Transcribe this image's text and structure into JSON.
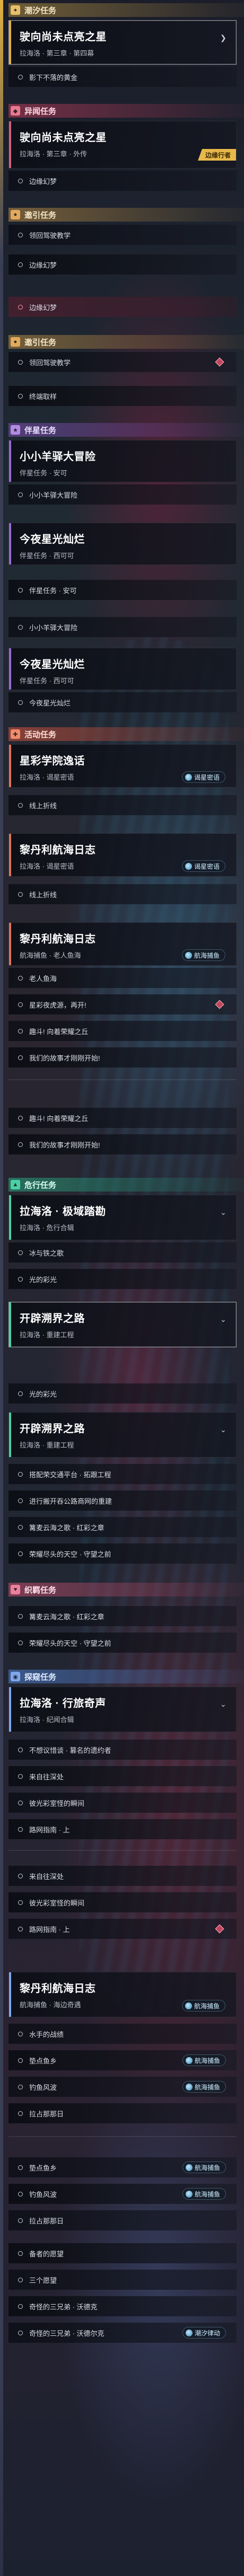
{
  "categories": {
    "tide": "潮汐任务",
    "odd": "异闻任务",
    "guide": "邀引任务",
    "partner": "伴星任务",
    "event": "活动任务",
    "danger": "危行任务",
    "bond": "织羁任务",
    "discovery": "探窥任务"
  },
  "quests": {
    "q1": {
      "title": "驶向尚未点亮之星",
      "sub": "拉海洛 · 第三章 · 第四幕"
    },
    "q2": {
      "title": "驶向尚未点亮之星",
      "sub": "拉海洛 · 第三章 · 外传",
      "tag": "边缘行者"
    },
    "q3": {
      "title": "小小羊驿大冒险",
      "sub": "伴星任务 · 安可"
    },
    "q4": {
      "title": "今夜星光灿烂",
      "sub": "伴星任务 · 西可可"
    },
    "q5": {
      "title": "今夜星光灿烂",
      "sub": "伴星任务 · 西可可"
    },
    "q6": {
      "title": "星彩学院逸话",
      "sub": "拉海洛 · 谒星密语"
    },
    "q7": {
      "title": "黎丹利航海日志",
      "sub": "拉海洛 · 谒星密语"
    },
    "q8": {
      "title": "黎丹利航海日志",
      "sub": "航海捕鱼 · 老人鱼海"
    },
    "q9": {
      "title": "拉海洛 · 极域踏勘",
      "sub": "拉海洛 · 危行合辑"
    },
    "q10": {
      "title": "开辟溯界之路",
      "sub": "拉海洛 · 重建工程"
    },
    "q11": {
      "title": "开辟溯界之路",
      "sub": "拉海洛 · 重建工程"
    },
    "q12": {
      "title": "拉海洛 · 行旅奇声",
      "sub": "拉海洛 · 纪闻合辑"
    },
    "q13": {
      "title": "黎丹利航海日志",
      "sub": "航海捕鱼 · 海边奇遇"
    }
  },
  "badges": {
    "whisper": "谒星密语",
    "fishing": "航海捕鱼",
    "tide": "潮汐律动"
  },
  "objectives": {
    "o1": "影下不落的黄金",
    "o2": "领回驾驶教学",
    "o3": "边缘幻梦",
    "o4": "领回驾驶教学",
    "o5": "边缘幻梦",
    "o6": "领回驾驶教学",
    "o7": "终端取样",
    "o8": "小小羊驿大冒险",
    "o9": "小小羊驿大冒险",
    "o10": "今夜星光灿烂",
    "o11": "线上折线",
    "o12": "线上折线",
    "o13": "老人鱼海",
    "o14": "星彩夜虎源，再开!",
    "o15": "趣斗! 向着荣耀之丘",
    "o16": "我们的故事才刚刚开始!",
    "o17": "趣斗! 向着荣耀之丘",
    "o18": "我们的故事才刚刚开始!",
    "o19": "冰与铁之歌",
    "o20": "光的彩光",
    "o21": "光的彩光",
    "o22": "搭配荣交通平台 · 拓跟工程",
    "o23": "进行搬开吞公路商网的重建",
    "o24": "篝麦云海之歌 · 红彩之章",
    "o25": "荣耀尽头的天空 · 守望之前",
    "o26": "篝麦云海之歌 · 红彩之章",
    "o27": "荣耀尽头的天空 · 守望之前",
    "o28": "不想议惜谈 · 篡名的遗约者",
    "o29": "来自往深处",
    "o30": "彼光彩室怪的瞬间",
    "o31": "路网指南 · 上",
    "o32": "来自往深处",
    "o33": "彼光彩室怪的瞬间",
    "o34": "路网指南 · 上",
    "o35": "水手的战绩",
    "o36": "垫点鱼乡",
    "o37": "钓鱼风波",
    "o38": "拉占那那日",
    "o39": "垫点鱼乡",
    "o40": "钓鱼风波",
    "o41": "拉占那那日",
    "o42": "备者的愿望",
    "o43": "三个愿望",
    "o44": "奇怪的三兄弟 · 沃德克",
    "o45": "奇怪的三兄弟 · 沃德尔克"
  }
}
